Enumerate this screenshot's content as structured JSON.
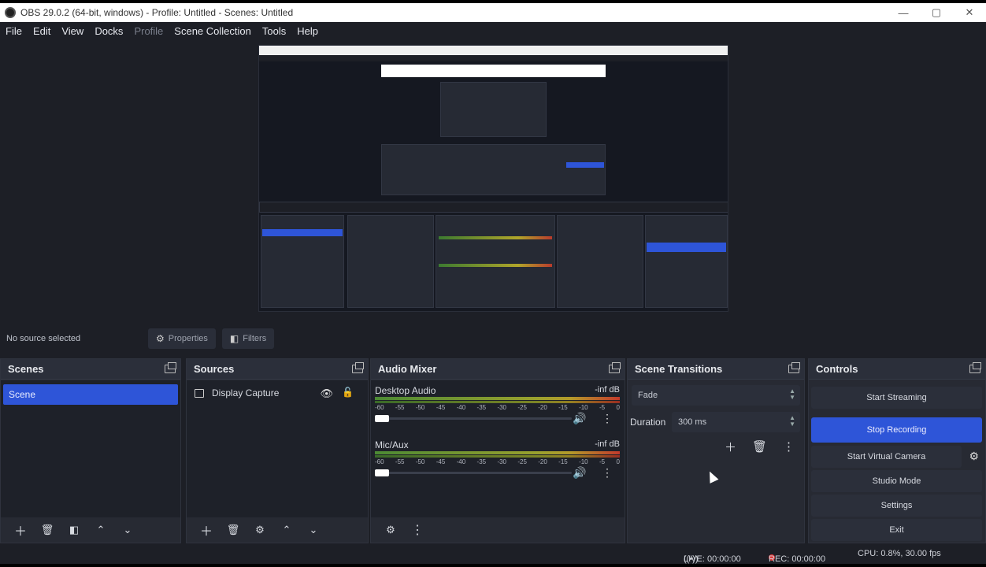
{
  "window": {
    "title": "OBS 29.0.2 (64-bit, windows) - Profile: Untitled - Scenes: Untitled",
    "minimize": "—",
    "maximize": "▢",
    "close": "✕"
  },
  "menu": [
    "File",
    "Edit",
    "View",
    "Docks",
    "Profile",
    "Scene Collection",
    "Tools",
    "Help"
  ],
  "source_toolbar": {
    "no_source": "No source selected",
    "properties": "Properties",
    "filters": "Filters"
  },
  "docks": {
    "scenes": {
      "title": "Scenes",
      "items": [
        "Scene"
      ]
    },
    "sources": {
      "title": "Sources",
      "items": [
        {
          "name": "Display Capture"
        }
      ]
    },
    "mixer": {
      "title": "Audio Mixer",
      "ticks": [
        "-60",
        "-55",
        "-50",
        "-45",
        "-40",
        "-35",
        "-30",
        "-25",
        "-20",
        "-15",
        "-10",
        "-5",
        "0"
      ],
      "channels": [
        {
          "name": "Desktop Audio",
          "db": "-inf dB",
          "volume": 0.0
        },
        {
          "name": "Mic/Aux",
          "db": "-inf dB",
          "volume": 0.0
        }
      ]
    },
    "transitions": {
      "title": "Scene Transitions",
      "type": "Fade",
      "duration_label": "Duration",
      "duration_value": "300 ms"
    },
    "controls": {
      "title": "Controls",
      "start_streaming": "Start Streaming",
      "stop_recording": "Stop Recording",
      "start_virtual_camera": "Start Virtual Camera",
      "studio_mode": "Studio Mode",
      "settings": "Settings",
      "exit": "Exit"
    }
  },
  "status": {
    "live": "LIVE: 00:00:00",
    "rec": "REC: 00:00:00",
    "cpu": "CPU: 0.8%, 30.00 fps"
  },
  "colors": {
    "accent": "#2e55d8",
    "rec": "#e23636",
    "background": "#1d1f26"
  }
}
